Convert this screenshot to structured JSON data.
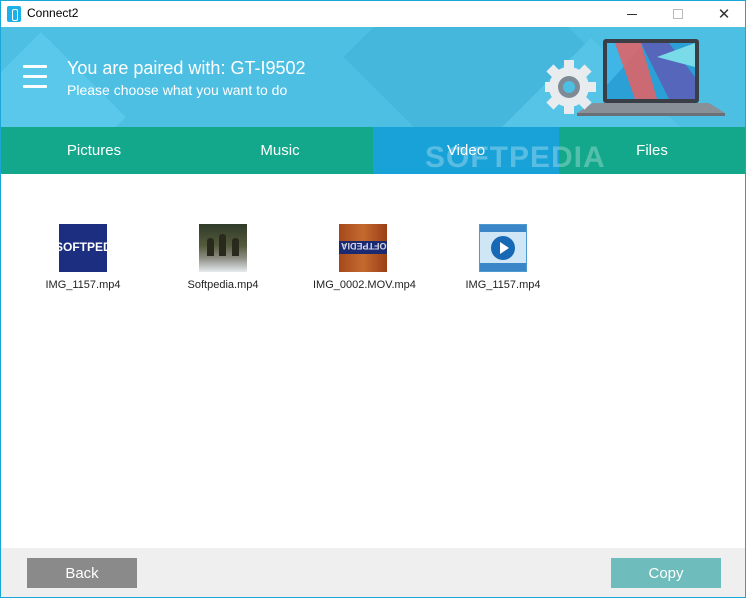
{
  "window": {
    "title": "Connect2"
  },
  "header": {
    "paired_prefix": "You are paired with: GT-I9502",
    "subtitle": "Please choose what you want to do"
  },
  "tabs": [
    {
      "label": "Pictures",
      "active": false
    },
    {
      "label": "Music",
      "active": false
    },
    {
      "label": "Video",
      "active": true
    },
    {
      "label": "Files",
      "active": false
    }
  ],
  "files": [
    {
      "name": "IMG_1157.mp4",
      "thumb_text": "SOFTPEDIA"
    },
    {
      "name": "Softpedia.mp4"
    },
    {
      "name": "IMG_0002.MOV.mp4",
      "thumb_text": "SOFTPEDIA"
    },
    {
      "name": "IMG_1157.mp4"
    }
  ],
  "footer": {
    "back_label": "Back",
    "copy_label": "Copy"
  },
  "watermark": "SOFTPEDIA",
  "colors": {
    "header_bg": "#4dbfe3",
    "tabs_bg": "#13a88b",
    "active_tab": "#19a2d8",
    "back_button": "#8a8a8a",
    "copy_button": "#6fbcbc"
  }
}
